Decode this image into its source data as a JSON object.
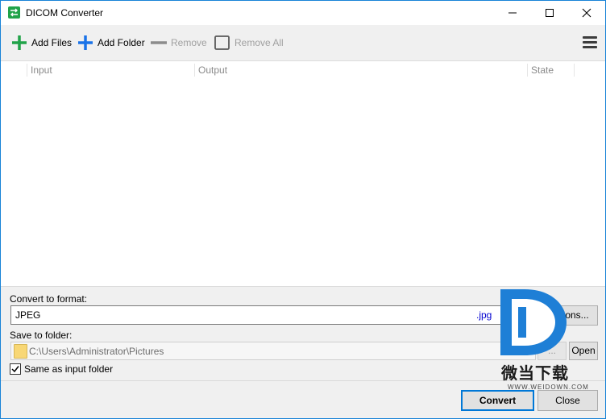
{
  "window": {
    "title": "DICOM Converter"
  },
  "titlebar_controls": {
    "minimize": "minimize-icon",
    "maximize": "maximize-icon",
    "close": "close-icon"
  },
  "toolbar": {
    "add_files": "Add Files",
    "add_folder": "Add Folder",
    "remove": "Remove",
    "remove_all": "Remove All"
  },
  "list": {
    "columns": [
      "Input",
      "Output",
      "State"
    ]
  },
  "convert": {
    "label": "Convert to format:",
    "format": "JPEG",
    "extension": ".jpg",
    "options_label": "Options..."
  },
  "save": {
    "label": "Save to folder:",
    "path": "C:\\Users\\Administrator\\Pictures",
    "browse_label": "...",
    "open_label": "Open",
    "same_as_input_label": "Same as input folder",
    "same_as_input_checked": true
  },
  "actions": {
    "convert_label": "Convert",
    "close_label": "Close"
  },
  "watermark": {
    "text": "微当下载",
    "url": "WWW.WEIDOWN.COM"
  },
  "colors": {
    "accent": "#0078d7",
    "add_green": "#21a349",
    "add_blue": "#1a73e8"
  }
}
